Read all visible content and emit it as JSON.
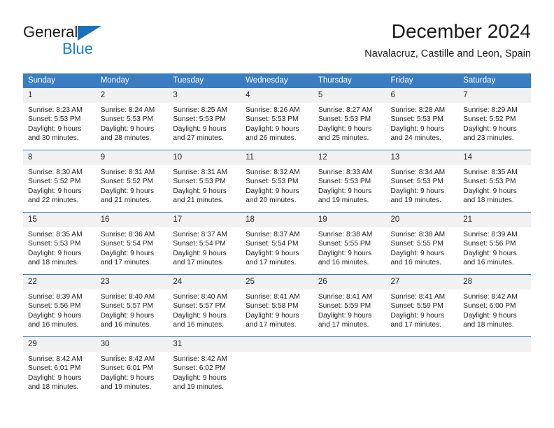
{
  "brand": {
    "name_part1": "General",
    "name_part2": "Blue"
  },
  "header": {
    "title": "December 2024",
    "subtitle": "Navalacruz, Castille and Leon, Spain"
  },
  "colors": {
    "header_blue": "#3b7dc0",
    "logo_blue": "#1c7fd4",
    "daynum_band": "#f1f1f1"
  },
  "weekday_headers": [
    "Sunday",
    "Monday",
    "Tuesday",
    "Wednesday",
    "Thursday",
    "Friday",
    "Saturday"
  ],
  "weeks": [
    [
      {
        "day": "1",
        "sunrise": "Sunrise: 8:23 AM",
        "sunset": "Sunset: 5:53 PM",
        "daylight_line1": "Daylight: 9 hours",
        "daylight_line2": "and 30 minutes."
      },
      {
        "day": "2",
        "sunrise": "Sunrise: 8:24 AM",
        "sunset": "Sunset: 5:53 PM",
        "daylight_line1": "Daylight: 9 hours",
        "daylight_line2": "and 28 minutes."
      },
      {
        "day": "3",
        "sunrise": "Sunrise: 8:25 AM",
        "sunset": "Sunset: 5:53 PM",
        "daylight_line1": "Daylight: 9 hours",
        "daylight_line2": "and 27 minutes."
      },
      {
        "day": "4",
        "sunrise": "Sunrise: 8:26 AM",
        "sunset": "Sunset: 5:53 PM",
        "daylight_line1": "Daylight: 9 hours",
        "daylight_line2": "and 26 minutes."
      },
      {
        "day": "5",
        "sunrise": "Sunrise: 8:27 AM",
        "sunset": "Sunset: 5:53 PM",
        "daylight_line1": "Daylight: 9 hours",
        "daylight_line2": "and 25 minutes."
      },
      {
        "day": "6",
        "sunrise": "Sunrise: 8:28 AM",
        "sunset": "Sunset: 5:53 PM",
        "daylight_line1": "Daylight: 9 hours",
        "daylight_line2": "and 24 minutes."
      },
      {
        "day": "7",
        "sunrise": "Sunrise: 8:29 AM",
        "sunset": "Sunset: 5:52 PM",
        "daylight_line1": "Daylight: 9 hours",
        "daylight_line2": "and 23 minutes."
      }
    ],
    [
      {
        "day": "8",
        "sunrise": "Sunrise: 8:30 AM",
        "sunset": "Sunset: 5:52 PM",
        "daylight_line1": "Daylight: 9 hours",
        "daylight_line2": "and 22 minutes."
      },
      {
        "day": "9",
        "sunrise": "Sunrise: 8:31 AM",
        "sunset": "Sunset: 5:52 PM",
        "daylight_line1": "Daylight: 9 hours",
        "daylight_line2": "and 21 minutes."
      },
      {
        "day": "10",
        "sunrise": "Sunrise: 8:31 AM",
        "sunset": "Sunset: 5:53 PM",
        "daylight_line1": "Daylight: 9 hours",
        "daylight_line2": "and 21 minutes."
      },
      {
        "day": "11",
        "sunrise": "Sunrise: 8:32 AM",
        "sunset": "Sunset: 5:53 PM",
        "daylight_line1": "Daylight: 9 hours",
        "daylight_line2": "and 20 minutes."
      },
      {
        "day": "12",
        "sunrise": "Sunrise: 8:33 AM",
        "sunset": "Sunset: 5:53 PM",
        "daylight_line1": "Daylight: 9 hours",
        "daylight_line2": "and 19 minutes."
      },
      {
        "day": "13",
        "sunrise": "Sunrise: 8:34 AM",
        "sunset": "Sunset: 5:53 PM",
        "daylight_line1": "Daylight: 9 hours",
        "daylight_line2": "and 19 minutes."
      },
      {
        "day": "14",
        "sunrise": "Sunrise: 8:35 AM",
        "sunset": "Sunset: 5:53 PM",
        "daylight_line1": "Daylight: 9 hours",
        "daylight_line2": "and 18 minutes."
      }
    ],
    [
      {
        "day": "15",
        "sunrise": "Sunrise: 8:35 AM",
        "sunset": "Sunset: 5:53 PM",
        "daylight_line1": "Daylight: 9 hours",
        "daylight_line2": "and 18 minutes."
      },
      {
        "day": "16",
        "sunrise": "Sunrise: 8:36 AM",
        "sunset": "Sunset: 5:54 PM",
        "daylight_line1": "Daylight: 9 hours",
        "daylight_line2": "and 17 minutes."
      },
      {
        "day": "17",
        "sunrise": "Sunrise: 8:37 AM",
        "sunset": "Sunset: 5:54 PM",
        "daylight_line1": "Daylight: 9 hours",
        "daylight_line2": "and 17 minutes."
      },
      {
        "day": "18",
        "sunrise": "Sunrise: 8:37 AM",
        "sunset": "Sunset: 5:54 PM",
        "daylight_line1": "Daylight: 9 hours",
        "daylight_line2": "and 17 minutes."
      },
      {
        "day": "19",
        "sunrise": "Sunrise: 8:38 AM",
        "sunset": "Sunset: 5:55 PM",
        "daylight_line1": "Daylight: 9 hours",
        "daylight_line2": "and 16 minutes."
      },
      {
        "day": "20",
        "sunrise": "Sunrise: 8:38 AM",
        "sunset": "Sunset: 5:55 PM",
        "daylight_line1": "Daylight: 9 hours",
        "daylight_line2": "and 16 minutes."
      },
      {
        "day": "21",
        "sunrise": "Sunrise: 8:39 AM",
        "sunset": "Sunset: 5:56 PM",
        "daylight_line1": "Daylight: 9 hours",
        "daylight_line2": "and 16 minutes."
      }
    ],
    [
      {
        "day": "22",
        "sunrise": "Sunrise: 8:39 AM",
        "sunset": "Sunset: 5:56 PM",
        "daylight_line1": "Daylight: 9 hours",
        "daylight_line2": "and 16 minutes."
      },
      {
        "day": "23",
        "sunrise": "Sunrise: 8:40 AM",
        "sunset": "Sunset: 5:57 PM",
        "daylight_line1": "Daylight: 9 hours",
        "daylight_line2": "and 16 minutes."
      },
      {
        "day": "24",
        "sunrise": "Sunrise: 8:40 AM",
        "sunset": "Sunset: 5:57 PM",
        "daylight_line1": "Daylight: 9 hours",
        "daylight_line2": "and 16 minutes."
      },
      {
        "day": "25",
        "sunrise": "Sunrise: 8:41 AM",
        "sunset": "Sunset: 5:58 PM",
        "daylight_line1": "Daylight: 9 hours",
        "daylight_line2": "and 17 minutes."
      },
      {
        "day": "26",
        "sunrise": "Sunrise: 8:41 AM",
        "sunset": "Sunset: 5:59 PM",
        "daylight_line1": "Daylight: 9 hours",
        "daylight_line2": "and 17 minutes."
      },
      {
        "day": "27",
        "sunrise": "Sunrise: 8:41 AM",
        "sunset": "Sunset: 5:59 PM",
        "daylight_line1": "Daylight: 9 hours",
        "daylight_line2": "and 17 minutes."
      },
      {
        "day": "28",
        "sunrise": "Sunrise: 8:42 AM",
        "sunset": "Sunset: 6:00 PM",
        "daylight_line1": "Daylight: 9 hours",
        "daylight_line2": "and 18 minutes."
      }
    ],
    [
      {
        "day": "29",
        "sunrise": "Sunrise: 8:42 AM",
        "sunset": "Sunset: 6:01 PM",
        "daylight_line1": "Daylight: 9 hours",
        "daylight_line2": "and 18 minutes."
      },
      {
        "day": "30",
        "sunrise": "Sunrise: 8:42 AM",
        "sunset": "Sunset: 6:01 PM",
        "daylight_line1": "Daylight: 9 hours",
        "daylight_line2": "and 19 minutes."
      },
      {
        "day": "31",
        "sunrise": "Sunrise: 8:42 AM",
        "sunset": "Sunset: 6:02 PM",
        "daylight_line1": "Daylight: 9 hours",
        "daylight_line2": "and 19 minutes."
      },
      {
        "day": "",
        "sunrise": "",
        "sunset": "",
        "daylight_line1": "",
        "daylight_line2": ""
      },
      {
        "day": "",
        "sunrise": "",
        "sunset": "",
        "daylight_line1": "",
        "daylight_line2": ""
      },
      {
        "day": "",
        "sunrise": "",
        "sunset": "",
        "daylight_line1": "",
        "daylight_line2": ""
      },
      {
        "day": "",
        "sunrise": "",
        "sunset": "",
        "daylight_line1": "",
        "daylight_line2": ""
      }
    ]
  ]
}
